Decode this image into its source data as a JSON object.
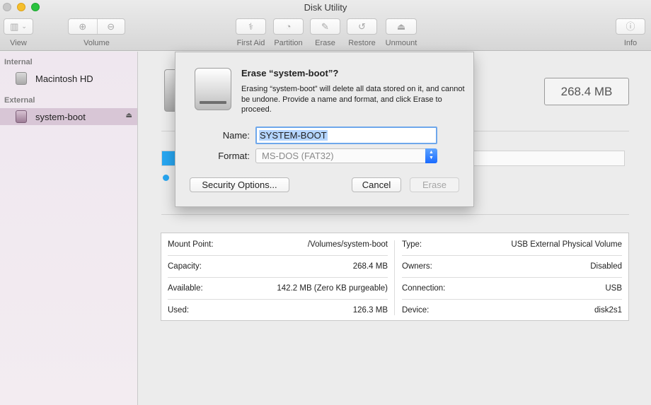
{
  "window": {
    "title": "Disk Utility"
  },
  "toolbar": {
    "view_label": "View",
    "volume_label": "Volume",
    "first_aid_label": "First Aid",
    "partition_label": "Partition",
    "erase_label": "Erase",
    "restore_label": "Restore",
    "unmount_label": "Unmount",
    "info_label": "Info"
  },
  "sidebar": {
    "internal_header": "Internal",
    "external_header": "External",
    "items": [
      {
        "label": "Macintosh HD",
        "section": "internal",
        "selected": false
      },
      {
        "label": "system-boot",
        "section": "external",
        "selected": true
      }
    ]
  },
  "main": {
    "capacity_badge": "268.4 MB",
    "usage_fraction": 0.47,
    "info": {
      "left": [
        {
          "label": "Mount Point:",
          "value": "/Volumes/system-boot"
        },
        {
          "label": "Capacity:",
          "value": "268.4 MB"
        },
        {
          "label": "Available:",
          "value": "142.2 MB (Zero KB purgeable)"
        },
        {
          "label": "Used:",
          "value": "126.3 MB"
        }
      ],
      "right": [
        {
          "label": "Type:",
          "value": "USB External Physical Volume"
        },
        {
          "label": "Owners:",
          "value": "Disabled"
        },
        {
          "label": "Connection:",
          "value": "USB"
        },
        {
          "label": "Device:",
          "value": "disk2s1"
        }
      ]
    }
  },
  "erase_sheet": {
    "title": "Erase “system-boot”?",
    "message": "Erasing “system-boot” will delete all data stored on it, and cannot be undone. Provide a name and format, and click Erase to proceed.",
    "name_label": "Name:",
    "name_value": "SYSTEM-BOOT",
    "format_label": "Format:",
    "format_value": "MS-DOS (FAT32)",
    "security_options_label": "Security Options...",
    "cancel_label": "Cancel",
    "erase_label": "Erase"
  },
  "colors": {
    "accent": "#27a6f1",
    "sidebar_selected": "#d8c6d6",
    "focus_ring": "#6ea7eb"
  }
}
